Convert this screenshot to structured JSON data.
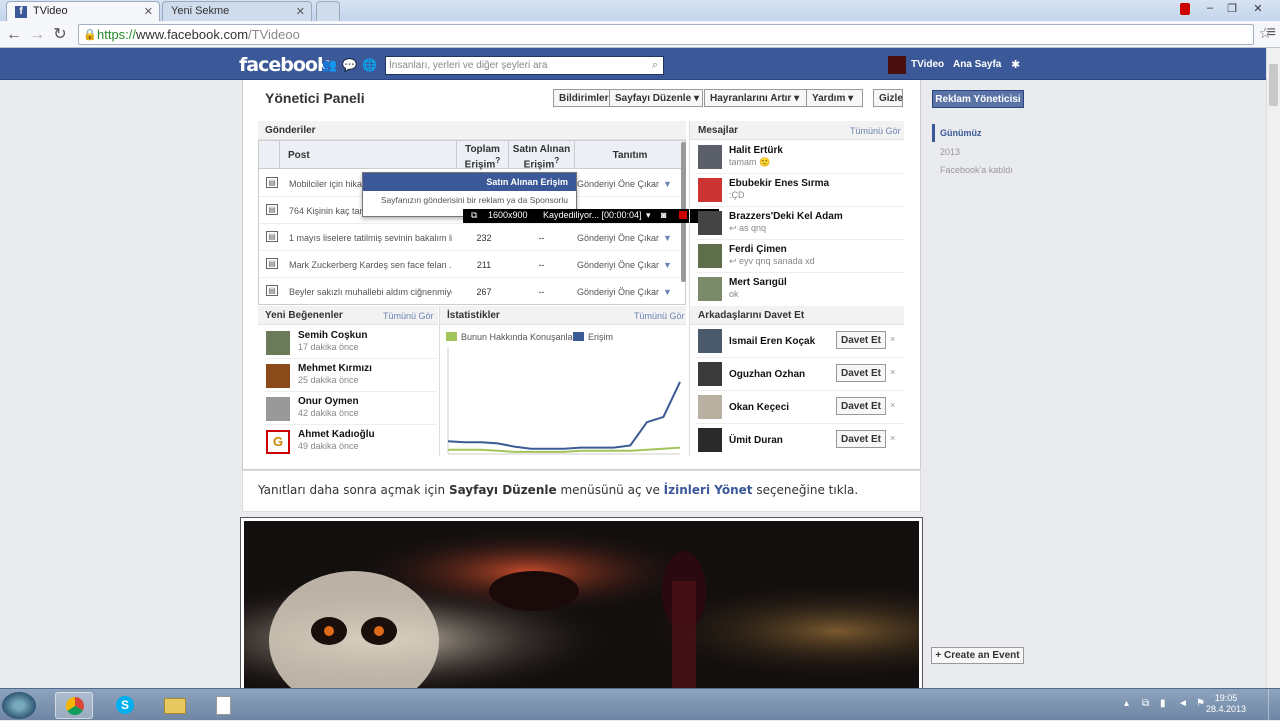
{
  "browser": {
    "tabs": [
      {
        "title": "TVideo",
        "active": true
      },
      {
        "title": "Yeni Sekme",
        "active": false
      }
    ],
    "url": {
      "scheme": "https://",
      "host": "www.facebook.com",
      "path": "/TVideoo"
    }
  },
  "fb": {
    "logo": "facebook",
    "search_placeholder": "İnsanları, yerleri ve diğer şeyleri ara",
    "user_link": "TVideo",
    "home_link": "Ana Sayfa"
  },
  "panel": {
    "title": "Yönetici Paneli",
    "buttons": [
      "Bildirimler",
      "Sayfayı Düzenle",
      "Hayranlarını Artır",
      "Yardım"
    ],
    "hide": "Gizle"
  },
  "posts": {
    "header": "Gönderiler",
    "col_post": "Post",
    "col_reach": "Toplam Erişim",
    "col_paid": "Satın Alınan Erişim",
    "col_promo": "Tanıtım",
    "help_mark": "?",
    "rows": [
      {
        "text": "Mobilciler için hikaye",
        "reach": "",
        "paid": "",
        "promo": "Gönderiyi Öne Çıkar"
      },
      {
        "text": "764 Kişinin kaç tane",
        "reach": "",
        "paid": "",
        "promo": ""
      },
      {
        "text": "1 mayıs liselere tatilmiş sevinin bakalım li...",
        "reach": "232",
        "paid": "--",
        "promo": "Gönderiyi Öne Çıkar"
      },
      {
        "text": "Mark Zuckerberg Kardeş sen face felan ...",
        "reach": "211",
        "paid": "--",
        "promo": "Gönderiyi Öne Çıkar"
      },
      {
        "text": "Beyler sakızlı muhallebi aldım ciğnenmiyo...",
        "reach": "267",
        "paid": "--",
        "promo": "Gönderiyi Öne Çıkar"
      }
    ],
    "tooltip_title": "Satın Alınan Erişim",
    "tooltip_body": "Sayfanızın gönderisini bir reklam ya da Sponsorlu"
  },
  "recorder": {
    "resolution": "1600x900",
    "status": "Kaydediliyor... [00:00:04]"
  },
  "messages": {
    "header": "Mesajlar",
    "see_all": "Tümünü Gör",
    "items": [
      {
        "name": "Halit Ertürk",
        "snippet": "tamam 🙂"
      },
      {
        "name": "Ebubekir Enes Sırma",
        "snippet": ":ÇD"
      },
      {
        "name": "Brazzers'Deki Kel Adam",
        "snippet": "↩ as qnq"
      },
      {
        "name": "Ferdi Çimen",
        "snippet": "↩ eyv qnq sanada xd"
      },
      {
        "name": "Mert Sarıgül",
        "snippet": "ok"
      }
    ]
  },
  "likes": {
    "header": "Yeni Beğenenler",
    "see_all": "Tümünü Gör",
    "items": [
      {
        "name": "Semih Coşkun",
        "time": "17 dakika önce"
      },
      {
        "name": "Mehmet Kırmızı",
        "time": "25 dakika önce"
      },
      {
        "name": "Onur Oymen",
        "time": "42 dakika önce"
      },
      {
        "name": "Ahmet Kadıoğlu",
        "time": "49 dakika önce"
      }
    ]
  },
  "stats": {
    "header": "İstatistikler",
    "see_all": "Tümünü Gör",
    "legend": [
      "Bunun Hakkında Konuşanlar",
      "Erişim"
    ],
    "colors": {
      "talking": "#a3c45a",
      "reach": "#3b5b94"
    }
  },
  "chart_data": {
    "type": "line",
    "title": "",
    "xlabel": "",
    "ylabel": "",
    "series": [
      {
        "name": "Bunun Hakkında Konuşanlar",
        "values": [
          4,
          4,
          4,
          3,
          2,
          2,
          2,
          2,
          3,
          3,
          3,
          3,
          4,
          5,
          6
        ]
      },
      {
        "name": "Erişim",
        "values": [
          12,
          11,
          11,
          10,
          7,
          5,
          5,
          5,
          6,
          6,
          6,
          8,
          30,
          35,
          68
        ]
      }
    ],
    "ylim": [
      0,
      100
    ],
    "grid": false
  },
  "invite": {
    "header": "Arkadaşlarını Davet Et",
    "button": "Davet Et",
    "close": "×",
    "items": [
      "Ismail Eren Koçak",
      "Oguzhan Ozhan",
      "Okan Keçeci",
      "Ümit Duran"
    ]
  },
  "instruction": {
    "pre": "Yanıtları daha sonra açmak için ",
    "bold1": "Sayfayı Düzenle",
    "mid": " menüsünü aç ve ",
    "bold2": "İzinleri Yönet",
    "post": " seçeneğine tıkla."
  },
  "right": {
    "ads_button": "Reklam Yöneticisi",
    "timeline": [
      "Günümüz",
      "2013",
      "Facebook'a katıldı"
    ],
    "create_event": "+ Create an Event"
  },
  "taskbar": {
    "time": "19:05",
    "date": "28.4.2013"
  }
}
